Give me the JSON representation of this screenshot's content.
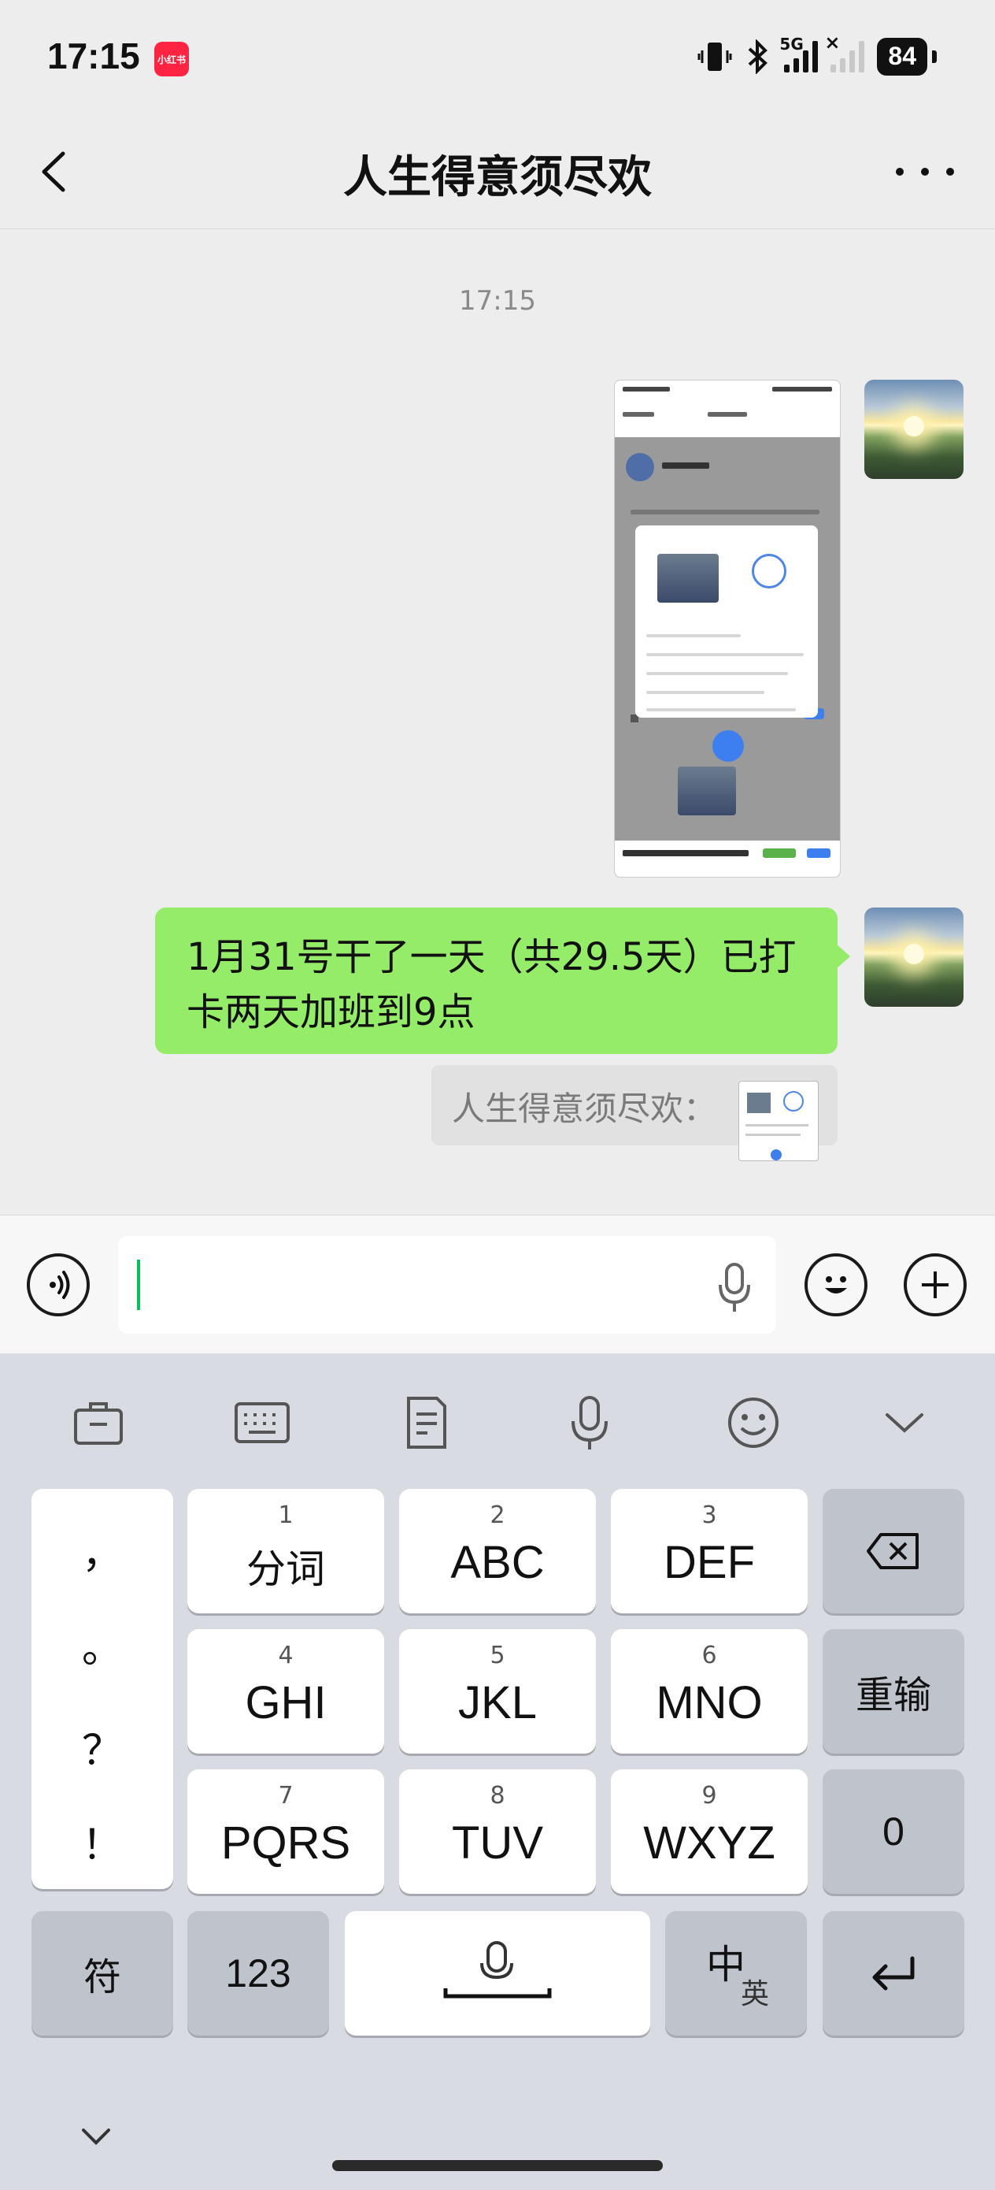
{
  "status_bar": {
    "time": "17:15",
    "app_badge": "小红书",
    "battery": "84",
    "network": "5G"
  },
  "nav": {
    "title": "人生得意须尽欢"
  },
  "chat": {
    "timestamp": "17:15",
    "messages": [
      {
        "type": "image",
        "sender": "me",
        "content": "attendance screenshot"
      },
      {
        "type": "text",
        "sender": "me",
        "text": "1月31号干了一天（共29.5天）已打卡两天加班到9点"
      }
    ],
    "quote": {
      "text": "人生得意须尽欢："
    }
  },
  "input": {
    "value": ""
  },
  "keyboard": {
    "toolbar": [
      "briefcase-icon",
      "keyboard-icon",
      "clipboard-icon",
      "mic-icon",
      "emoji-icon",
      "chevron-down-icon"
    ],
    "punctuation": [
      "，",
      "。",
      "？",
      "！"
    ],
    "keys": [
      {
        "num": "1",
        "label": "分词"
      },
      {
        "num": "2",
        "label": "ABC"
      },
      {
        "num": "3",
        "label": "DEF"
      },
      {
        "num": "4",
        "label": "GHI"
      },
      {
        "num": "5",
        "label": "JKL"
      },
      {
        "num": "6",
        "label": "MNO"
      },
      {
        "num": "7",
        "label": "PQRS"
      },
      {
        "num": "8",
        "label": "TUV"
      },
      {
        "num": "9",
        "label": "WXYZ"
      }
    ],
    "reinput": "重输",
    "zero": "0",
    "symbols": "符",
    "numbers": "123",
    "lang_main": "中",
    "lang_alt": "英"
  }
}
